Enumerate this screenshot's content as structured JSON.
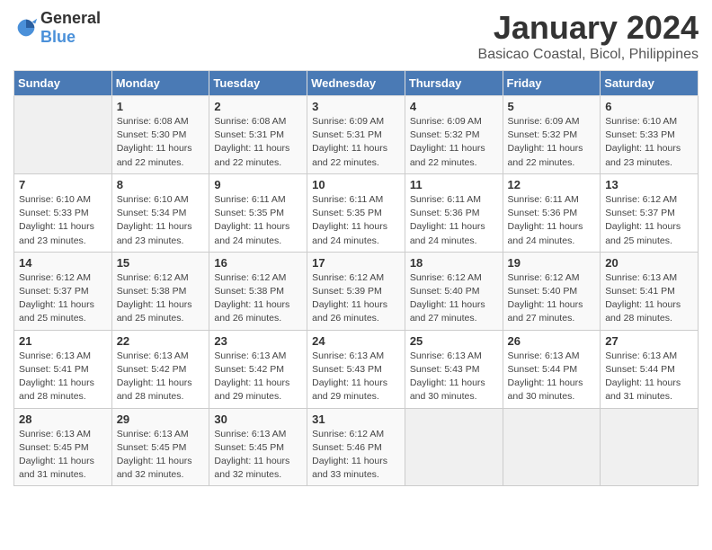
{
  "header": {
    "logo_general": "General",
    "logo_blue": "Blue",
    "title": "January 2024",
    "subtitle": "Basicao Coastal, Bicol, Philippines"
  },
  "calendar": {
    "days_of_week": [
      "Sunday",
      "Monday",
      "Tuesday",
      "Wednesday",
      "Thursday",
      "Friday",
      "Saturday"
    ],
    "weeks": [
      [
        {
          "day": "",
          "sunrise": "",
          "sunset": "",
          "daylight": ""
        },
        {
          "day": "1",
          "sunrise": "Sunrise: 6:08 AM",
          "sunset": "Sunset: 5:30 PM",
          "daylight": "Daylight: 11 hours and 22 minutes."
        },
        {
          "day": "2",
          "sunrise": "Sunrise: 6:08 AM",
          "sunset": "Sunset: 5:31 PM",
          "daylight": "Daylight: 11 hours and 22 minutes."
        },
        {
          "day": "3",
          "sunrise": "Sunrise: 6:09 AM",
          "sunset": "Sunset: 5:31 PM",
          "daylight": "Daylight: 11 hours and 22 minutes."
        },
        {
          "day": "4",
          "sunrise": "Sunrise: 6:09 AM",
          "sunset": "Sunset: 5:32 PM",
          "daylight": "Daylight: 11 hours and 22 minutes."
        },
        {
          "day": "5",
          "sunrise": "Sunrise: 6:09 AM",
          "sunset": "Sunset: 5:32 PM",
          "daylight": "Daylight: 11 hours and 22 minutes."
        },
        {
          "day": "6",
          "sunrise": "Sunrise: 6:10 AM",
          "sunset": "Sunset: 5:33 PM",
          "daylight": "Daylight: 11 hours and 23 minutes."
        }
      ],
      [
        {
          "day": "7",
          "sunrise": "Sunrise: 6:10 AM",
          "sunset": "Sunset: 5:33 PM",
          "daylight": "Daylight: 11 hours and 23 minutes."
        },
        {
          "day": "8",
          "sunrise": "Sunrise: 6:10 AM",
          "sunset": "Sunset: 5:34 PM",
          "daylight": "Daylight: 11 hours and 23 minutes."
        },
        {
          "day": "9",
          "sunrise": "Sunrise: 6:11 AM",
          "sunset": "Sunset: 5:35 PM",
          "daylight": "Daylight: 11 hours and 24 minutes."
        },
        {
          "day": "10",
          "sunrise": "Sunrise: 6:11 AM",
          "sunset": "Sunset: 5:35 PM",
          "daylight": "Daylight: 11 hours and 24 minutes."
        },
        {
          "day": "11",
          "sunrise": "Sunrise: 6:11 AM",
          "sunset": "Sunset: 5:36 PM",
          "daylight": "Daylight: 11 hours and 24 minutes."
        },
        {
          "day": "12",
          "sunrise": "Sunrise: 6:11 AM",
          "sunset": "Sunset: 5:36 PM",
          "daylight": "Daylight: 11 hours and 24 minutes."
        },
        {
          "day": "13",
          "sunrise": "Sunrise: 6:12 AM",
          "sunset": "Sunset: 5:37 PM",
          "daylight": "Daylight: 11 hours and 25 minutes."
        }
      ],
      [
        {
          "day": "14",
          "sunrise": "Sunrise: 6:12 AM",
          "sunset": "Sunset: 5:37 PM",
          "daylight": "Daylight: 11 hours and 25 minutes."
        },
        {
          "day": "15",
          "sunrise": "Sunrise: 6:12 AM",
          "sunset": "Sunset: 5:38 PM",
          "daylight": "Daylight: 11 hours and 25 minutes."
        },
        {
          "day": "16",
          "sunrise": "Sunrise: 6:12 AM",
          "sunset": "Sunset: 5:38 PM",
          "daylight": "Daylight: 11 hours and 26 minutes."
        },
        {
          "day": "17",
          "sunrise": "Sunrise: 6:12 AM",
          "sunset": "Sunset: 5:39 PM",
          "daylight": "Daylight: 11 hours and 26 minutes."
        },
        {
          "day": "18",
          "sunrise": "Sunrise: 6:12 AM",
          "sunset": "Sunset: 5:40 PM",
          "daylight": "Daylight: 11 hours and 27 minutes."
        },
        {
          "day": "19",
          "sunrise": "Sunrise: 6:12 AM",
          "sunset": "Sunset: 5:40 PM",
          "daylight": "Daylight: 11 hours and 27 minutes."
        },
        {
          "day": "20",
          "sunrise": "Sunrise: 6:13 AM",
          "sunset": "Sunset: 5:41 PM",
          "daylight": "Daylight: 11 hours and 28 minutes."
        }
      ],
      [
        {
          "day": "21",
          "sunrise": "Sunrise: 6:13 AM",
          "sunset": "Sunset: 5:41 PM",
          "daylight": "Daylight: 11 hours and 28 minutes."
        },
        {
          "day": "22",
          "sunrise": "Sunrise: 6:13 AM",
          "sunset": "Sunset: 5:42 PM",
          "daylight": "Daylight: 11 hours and 28 minutes."
        },
        {
          "day": "23",
          "sunrise": "Sunrise: 6:13 AM",
          "sunset": "Sunset: 5:42 PM",
          "daylight": "Daylight: 11 hours and 29 minutes."
        },
        {
          "day": "24",
          "sunrise": "Sunrise: 6:13 AM",
          "sunset": "Sunset: 5:43 PM",
          "daylight": "Daylight: 11 hours and 29 minutes."
        },
        {
          "day": "25",
          "sunrise": "Sunrise: 6:13 AM",
          "sunset": "Sunset: 5:43 PM",
          "daylight": "Daylight: 11 hours and 30 minutes."
        },
        {
          "day": "26",
          "sunrise": "Sunrise: 6:13 AM",
          "sunset": "Sunset: 5:44 PM",
          "daylight": "Daylight: 11 hours and 30 minutes."
        },
        {
          "day": "27",
          "sunrise": "Sunrise: 6:13 AM",
          "sunset": "Sunset: 5:44 PM",
          "daylight": "Daylight: 11 hours and 31 minutes."
        }
      ],
      [
        {
          "day": "28",
          "sunrise": "Sunrise: 6:13 AM",
          "sunset": "Sunset: 5:45 PM",
          "daylight": "Daylight: 11 hours and 31 minutes."
        },
        {
          "day": "29",
          "sunrise": "Sunrise: 6:13 AM",
          "sunset": "Sunset: 5:45 PM",
          "daylight": "Daylight: 11 hours and 32 minutes."
        },
        {
          "day": "30",
          "sunrise": "Sunrise: 6:13 AM",
          "sunset": "Sunset: 5:45 PM",
          "daylight": "Daylight: 11 hours and 32 minutes."
        },
        {
          "day": "31",
          "sunrise": "Sunrise: 6:12 AM",
          "sunset": "Sunset: 5:46 PM",
          "daylight": "Daylight: 11 hours and 33 minutes."
        },
        {
          "day": "",
          "sunrise": "",
          "sunset": "",
          "daylight": ""
        },
        {
          "day": "",
          "sunrise": "",
          "sunset": "",
          "daylight": ""
        },
        {
          "day": "",
          "sunrise": "",
          "sunset": "",
          "daylight": ""
        }
      ]
    ]
  }
}
